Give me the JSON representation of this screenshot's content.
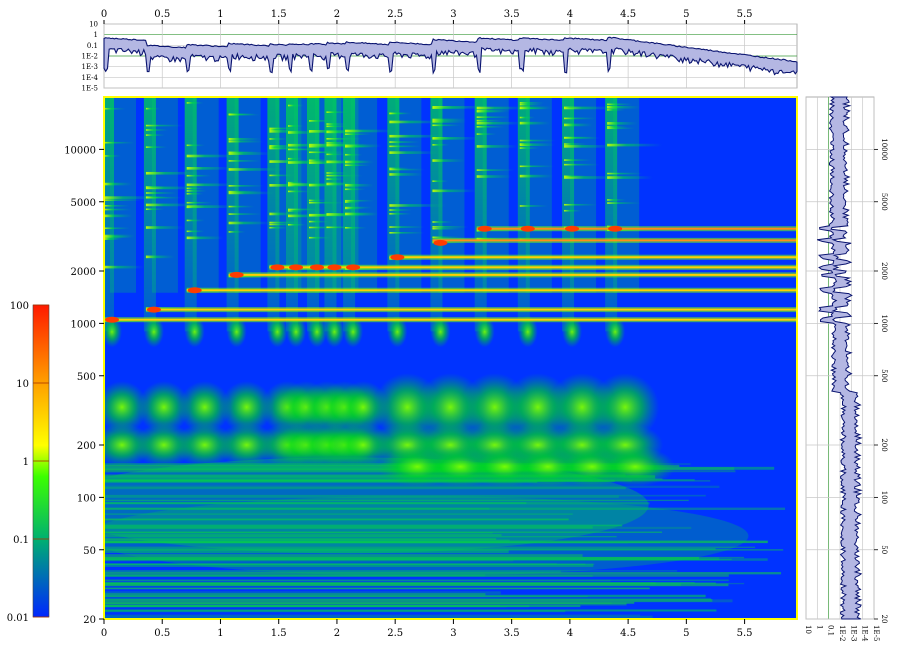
{
  "chart_data": [
    {
      "type": "heatmap",
      "title": "",
      "xlabel": "",
      "ylabel": "",
      "x_ticks": [
        "0",
        "0.5",
        "1",
        "1.5",
        "2",
        "2.5",
        "3",
        "3.5",
        "4",
        "4.5",
        "5",
        "5.5"
      ],
      "x_tick_values": [
        0,
        0.5,
        1,
        1.5,
        2,
        2.5,
        3,
        3.5,
        4,
        4.5,
        5,
        5.5
      ],
      "xlim": [
        0,
        5.95
      ],
      "y_scale": "log",
      "ylim": [
        20,
        20000
      ],
      "y_ticks": [
        "20",
        "50",
        "100",
        "200",
        "500",
        "1000",
        "2000",
        "5000",
        "10000"
      ],
      "y_tick_values": [
        20,
        50,
        100,
        200,
        500,
        1000,
        2000,
        5000,
        10000
      ],
      "onsets": [
        0.0,
        0.36,
        0.71,
        1.07,
        1.42,
        1.58,
        1.76,
        1.91,
        2.07,
        2.45,
        2.82,
        3.2,
        3.57,
        3.95,
        4.32
      ],
      "onset_fundamentals": [
        1050,
        1200,
        1550,
        1900,
        2100,
        2100,
        2100,
        2100,
        2100,
        2400,
        2900,
        3500,
        3500,
        3500,
        3500
      ],
      "sustained_partials": [
        1050,
        1200,
        1550,
        1900,
        2100,
        2400,
        3000,
        3500
      ],
      "colorbar": {
        "scale": "log",
        "ticks": [
          "100",
          "10",
          "1",
          "0.1",
          "0.01"
        ],
        "tick_values": [
          100,
          10,
          1,
          0.1,
          0.01
        ],
        "colors": [
          "#ff1a00",
          "#ff8000",
          "#ffff00",
          "#00e600",
          "#0033ff"
        ]
      }
    },
    {
      "type": "area",
      "name": "time-envelope",
      "y_scale": "log",
      "y_ticks": [
        "10",
        "1",
        "0.1",
        "1E-2",
        "1E-3",
        "1E-4",
        "1E-5"
      ],
      "y_tick_values": [
        10,
        1,
        0.1,
        0.01,
        0.001,
        0.0001,
        1e-05
      ],
      "x_ticks": [
        "0",
        "0.5",
        "1",
        "1.5",
        "2",
        "2.5",
        "3",
        "3.5",
        "4",
        "4.5",
        "5",
        "5.5"
      ],
      "xlim": [
        0,
        5.95
      ],
      "onsets": [
        0.0,
        0.36,
        0.71,
        1.07,
        1.42,
        1.58,
        1.76,
        1.91,
        2.07,
        2.45,
        2.82,
        3.2,
        3.57,
        3.95,
        4.32
      ],
      "peak_levels": [
        0.5,
        0.1,
        0.12,
        0.15,
        0.13,
        0.15,
        0.15,
        0.18,
        0.2,
        0.2,
        0.35,
        0.5,
        0.5,
        0.5,
        0.6
      ],
      "end_level": 0.003
    },
    {
      "type": "area",
      "name": "frequency-spectrum",
      "x_scale": "log",
      "x_ticks": [
        "1E-5",
        "1E-4",
        "1E-3",
        "1E-2",
        "0.1",
        "1",
        "10"
      ],
      "x_tick_values": [
        1e-05,
        0.0001,
        0.001,
        0.01,
        0.1,
        1,
        10
      ],
      "y_ticks": [
        "20",
        "50",
        "100",
        "200",
        "500",
        "1000",
        "2000",
        "5000",
        "10000"
      ],
      "y_tick_values": [
        20,
        50,
        100,
        200,
        500,
        1000,
        2000,
        5000,
        10000
      ],
      "ylim": [
        20,
        20000
      ]
    }
  ],
  "colors": {
    "background": "#ffffff",
    "heatmap_base": "#0033ff",
    "frame_highlight": "#ffff00",
    "envelope_fill": "#b4b7e3",
    "envelope_line": "#0a1470",
    "gridline_green": "#3a9a3a"
  }
}
